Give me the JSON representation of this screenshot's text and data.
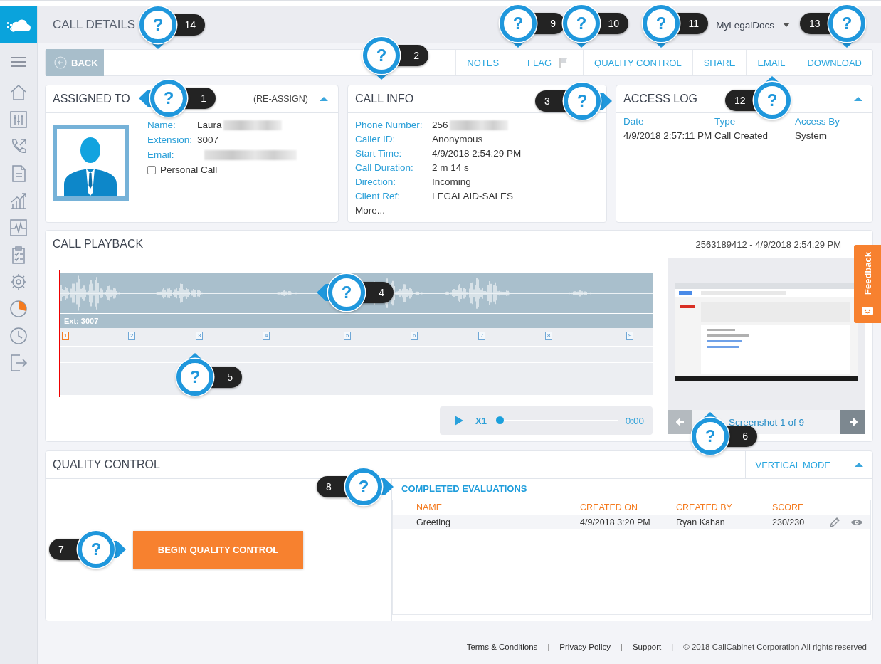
{
  "sidebar": {
    "items": [
      {
        "selected": false
      },
      {
        "selected": false
      },
      {
        "selected": false
      },
      {
        "selected": false
      },
      {
        "selected": false
      },
      {
        "selected": false
      },
      {
        "selected": false
      },
      {
        "selected": false
      },
      {
        "selected": true
      },
      {
        "selected": false
      },
      {
        "selected": false
      }
    ]
  },
  "header": {
    "title": "CALL DETAILS",
    "account": "MyLegalDocs"
  },
  "toolbar": {
    "back": "BACK",
    "actions": [
      {
        "label": "NOTES",
        "kind": "text"
      },
      {
        "label": "FLAG",
        "kind": "flag"
      },
      {
        "label": "QUALITY CONTROL",
        "kind": "text"
      },
      {
        "label": "SHARE",
        "kind": "text"
      },
      {
        "label": "EMAIL",
        "kind": "text"
      },
      {
        "label": "DOWNLOAD",
        "kind": "text"
      }
    ]
  },
  "assigned_to": {
    "title": "ASSIGNED TO",
    "action": "(RE-ASSIGN)",
    "expanded": true,
    "fields": [
      {
        "label": "Name:",
        "value": "Laura",
        "redacted": true
      },
      {
        "label": "Extension:",
        "value": "3007"
      },
      {
        "label": "Email:",
        "redacted": true
      }
    ],
    "personal_call": {
      "label": "Personal Call",
      "checked": false
    }
  },
  "call_info": {
    "title": "CALL INFO",
    "fields": [
      {
        "label": "Phone Number:",
        "value": "256",
        "redacted": true
      },
      {
        "label": "Caller ID:",
        "value": "Anonymous"
      },
      {
        "label": "Start Time:",
        "value": "4/9/2018 2:54:29 PM"
      },
      {
        "label": "Call Duration:",
        "value": "2 m 14 s"
      },
      {
        "label": "Direction:",
        "value": "Incoming"
      },
      {
        "label": "Client Ref:",
        "value": "LEGALAID-SALES"
      }
    ],
    "more": "More..."
  },
  "access_log": {
    "title": "ACCESS LOG",
    "expanded": true,
    "columns": [
      "Date",
      "Type",
      "Access By"
    ],
    "rows": [
      [
        "4/9/2018 2:57:11 PM",
        "Call Created",
        "System"
      ]
    ]
  },
  "playback": {
    "title": "CALL PLAYBACK",
    "subtitle": "2563189412 - 4/9/2018 2:54:29 PM",
    "track_label": "Ext: 3007",
    "markers": [
      {
        "label": "1",
        "selected": true
      },
      {
        "label": "2",
        "selected": false
      },
      {
        "label": "3",
        "selected": false
      },
      {
        "label": "4",
        "selected": false
      },
      {
        "label": "5",
        "selected": false
      },
      {
        "label": "6",
        "selected": false
      },
      {
        "label": "7",
        "selected": false
      },
      {
        "label": "8",
        "selected": false
      },
      {
        "label": "9",
        "selected": false
      }
    ],
    "player": {
      "speed": "X1",
      "level": 0,
      "time": "0:00"
    },
    "screenshots": {
      "caption": "Screenshot 1 of 9",
      "prev": {
        "disabled": true
      },
      "next": {
        "disabled": false
      }
    }
  },
  "feedback": "Feedback",
  "quality_control": {
    "title": "QUALITY CONTROL",
    "mode_button": "VERTICAL MODE",
    "expanded": true,
    "begin_button": "BEGIN QUALITY CONTROL",
    "evaluations": {
      "title": "COMPLETED EVALUATIONS",
      "columns": [
        "NAME",
        "CREATED ON",
        "CREATED BY",
        "SCORE"
      ],
      "rows": [
        {
          "cells": [
            "Greeting",
            "4/9/2018 3:20 PM",
            "Ryan Kahan",
            "230/230"
          ]
        }
      ]
    }
  },
  "footer": {
    "items": [
      {
        "kind": "link",
        "text": "Terms & Conditions"
      },
      {
        "kind": "separator",
        "text": "|"
      },
      {
        "kind": "link",
        "text": "Privacy Policy"
      },
      {
        "kind": "separator",
        "text": "|"
      },
      {
        "kind": "link",
        "text": "Support"
      },
      {
        "kind": "separator",
        "text": "|"
      },
      {
        "kind": "text",
        "text": "© 2018 CallCabinet Corporation All rights reserved"
      }
    ]
  },
  "callouts": [
    {
      "symbol": "?",
      "number": "14"
    },
    {
      "symbol": "?",
      "number": "9"
    },
    {
      "symbol": "?",
      "number": "10"
    },
    {
      "symbol": "?",
      "number": "11"
    },
    {
      "symbol": "?",
      "number": "13"
    },
    {
      "symbol": "?",
      "number": "2"
    },
    {
      "symbol": "?",
      "number": "1"
    },
    {
      "symbol": "?",
      "number": "3"
    },
    {
      "symbol": "?",
      "number": "12"
    },
    {
      "symbol": "?",
      "number": "4"
    },
    {
      "symbol": "?",
      "number": "5"
    },
    {
      "symbol": "?",
      "number": "6"
    },
    {
      "symbol": "?",
      "number": "8"
    },
    {
      "symbol": "?",
      "number": "7"
    }
  ]
}
